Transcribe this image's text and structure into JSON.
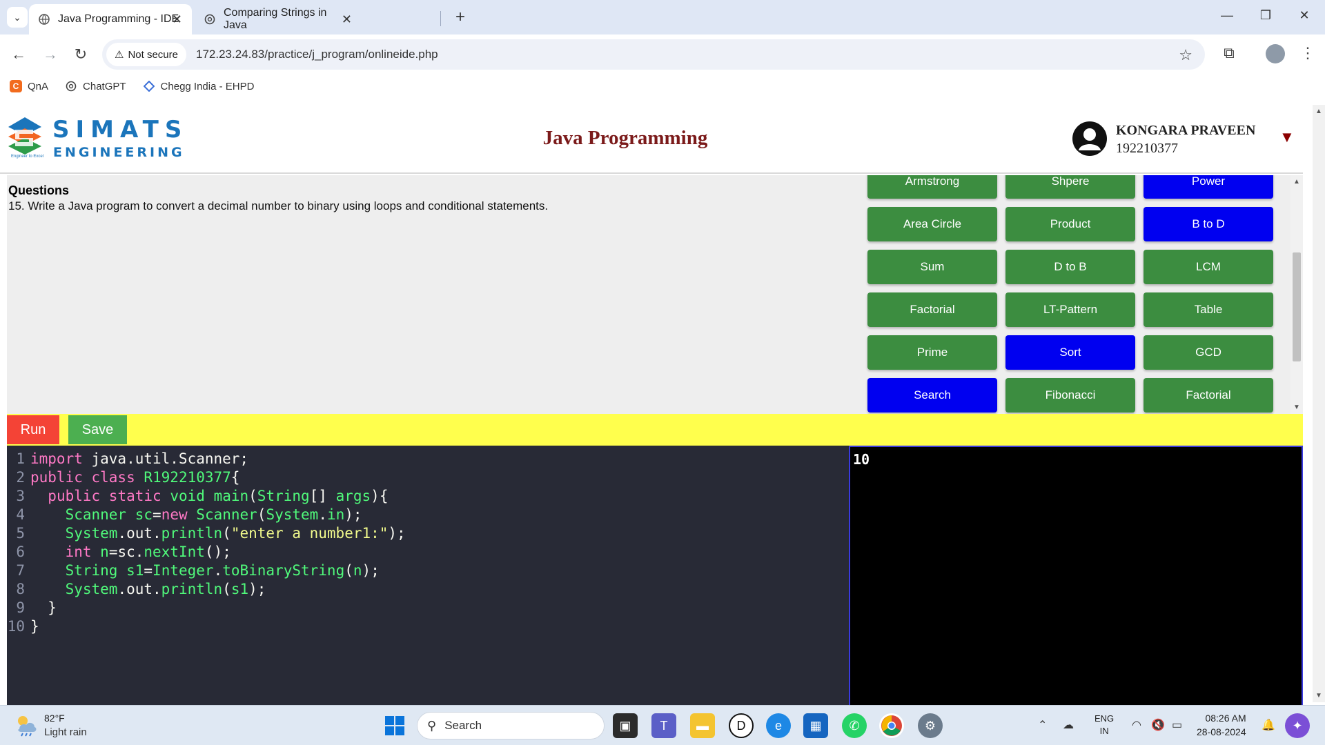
{
  "browser": {
    "tabs": [
      {
        "title": "Java Programming - IDE",
        "active": true
      },
      {
        "title": "Comparing Strings in Java",
        "active": false
      }
    ],
    "security_label": "Not secure",
    "url": "172.23.24.83/practice/j_program/onlineide.php",
    "bookmarks": [
      "QnA",
      "ChatGPT",
      "Chegg India - EHPD"
    ]
  },
  "header": {
    "logo_top": "SIMATS",
    "logo_bottom": "ENGINEERING",
    "logo_tagline": "Engineer to Excel",
    "title": "Java Programming",
    "user_name": "KONGARA PRAVEEN",
    "user_id": "192210377"
  },
  "questions": {
    "heading": "Questions",
    "text": "15. Write a Java program to convert a decimal number to binary using loops and conditional statements."
  },
  "programs": [
    {
      "label": "Armstrong",
      "color": "green"
    },
    {
      "label": "Shpere",
      "color": "green"
    },
    {
      "label": "Power",
      "color": "blue"
    },
    {
      "label": "Area Circle",
      "color": "green"
    },
    {
      "label": "Product",
      "color": "green"
    },
    {
      "label": "B to D",
      "color": "blue"
    },
    {
      "label": "Sum",
      "color": "green"
    },
    {
      "label": "D to B",
      "color": "green"
    },
    {
      "label": "LCM",
      "color": "green"
    },
    {
      "label": "Factorial",
      "color": "green"
    },
    {
      "label": "LT-Pattern",
      "color": "green"
    },
    {
      "label": "Table",
      "color": "green"
    },
    {
      "label": "Prime",
      "color": "green"
    },
    {
      "label": "Sort",
      "color": "blue"
    },
    {
      "label": "GCD",
      "color": "green"
    },
    {
      "label": "Search",
      "color": "blue"
    },
    {
      "label": "Fibonacci",
      "color": "green"
    },
    {
      "label": "Factorial",
      "color": "green"
    }
  ],
  "actions": {
    "run": "Run",
    "save": "Save"
  },
  "editor": {
    "line_numbers": [
      "1",
      "2",
      "3",
      "4",
      "5",
      "6",
      "7",
      "8",
      "9",
      "10"
    ],
    "lines": [
      "import java.util.Scanner;",
      "public class R192210377{",
      "  public static void main(String[] args){",
      "    Scanner sc=new Scanner(System.in);",
      "    System.out.println(\"enter a number1:\");",
      "    int n=sc.nextInt();",
      "    String s1=Integer.toBinaryString(n);",
      "    System.out.println(s1);",
      "  }",
      "}"
    ]
  },
  "console": {
    "output": "10"
  },
  "taskbar": {
    "temperature": "82°F",
    "weather": "Light rain",
    "search_placeholder": "Search",
    "lang_top": "ENG",
    "lang_bottom": "IN",
    "time": "08:26 AM",
    "date": "28-08-2024"
  },
  "colors": {
    "green": "#3c8d40",
    "blue": "#0000f0",
    "run": "#f44336",
    "save": "#4caf50",
    "action_bar": "#ffff4d",
    "title": "#7b1a1a"
  }
}
